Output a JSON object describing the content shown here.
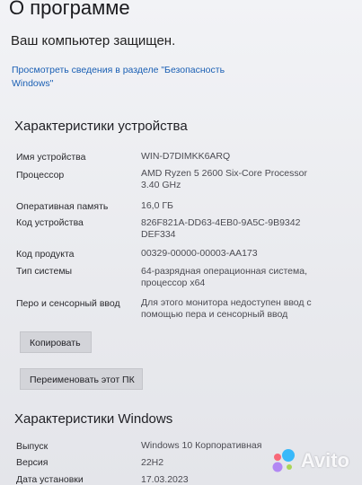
{
  "page": {
    "title": "О программе",
    "protected_text": "Ваш компьютер защищен.",
    "security_link": "Просмотреть сведения в разделе \"Безопасность Windows\""
  },
  "device_specs": {
    "heading": "Характеристики устройства",
    "rows": [
      {
        "label": "Имя устройства",
        "value": "WIN-D7DIMKK6ARQ"
      },
      {
        "label": "Процессор",
        "value": "AMD Ryzen 5 2600 Six-Core Processor 3.40 GHz"
      },
      {
        "label": "Оперативная память",
        "value": "16,0 ГБ"
      },
      {
        "label": "Код устройства",
        "value": "826F821A-DD63-4EB0-9A5C-9B9342DEF334"
      },
      {
        "label": "Код продукта",
        "value": "00329-00000-00003-AA173"
      },
      {
        "label": "Тип системы",
        "value": "64-разрядная операционная система, процессор x64"
      },
      {
        "label": "Перо и сенсорный ввод",
        "value": "Для этого монитора недоступен ввод с помощью пера и сенсорный ввод"
      }
    ],
    "copy_button": "Копировать",
    "rename_button": "Переименовать этот ПК"
  },
  "windows_specs": {
    "heading": "Характеристики Windows",
    "rows": [
      {
        "label": "Выпуск",
        "value": "Windows 10 Корпоративная"
      },
      {
        "label": "Версия",
        "value": "22H2"
      },
      {
        "label": "Дата установки",
        "value": "17.03.2023"
      }
    ]
  },
  "watermark": {
    "text": "Avito",
    "colors": [
      "#00aaff",
      "#a169f7",
      "#ff4053",
      "#97cf26"
    ]
  }
}
